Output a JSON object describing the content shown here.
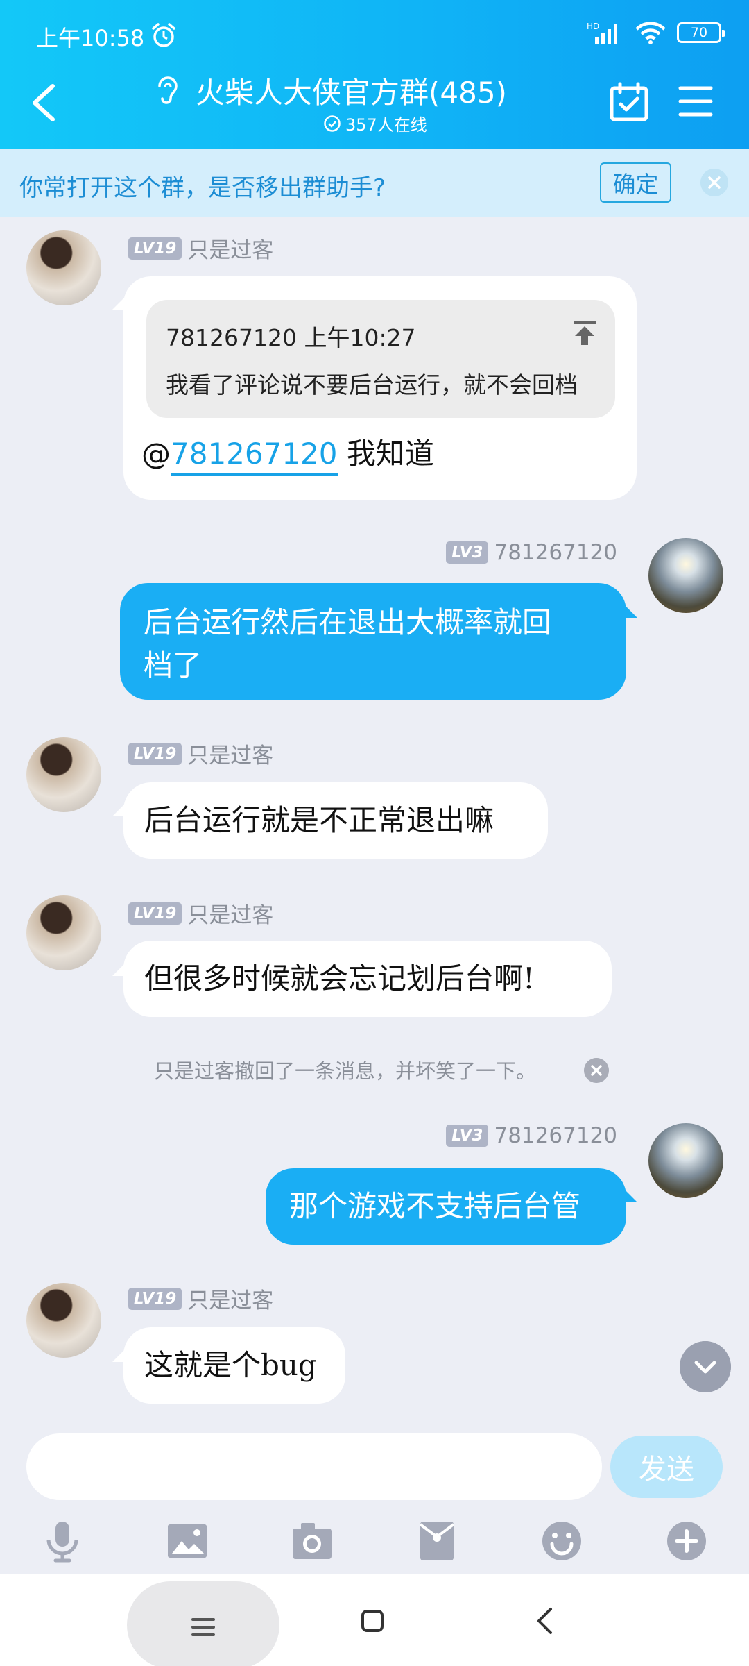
{
  "status_bar": {
    "time": "上午10:58",
    "network": "HD",
    "battery": "70"
  },
  "header": {
    "title": "火柴人大侠官方群(485)",
    "online": "357人在线"
  },
  "banner": {
    "text": "你常打开这个群，是否移出群助手?",
    "confirm": "确定"
  },
  "users": {
    "other": {
      "level": "LV19",
      "name": "只是过客"
    },
    "self": {
      "level": "LV3",
      "name": "781267120"
    }
  },
  "messages": {
    "m1": {
      "quote_author": "781267120 上午10:27",
      "quote_text": "我看了评论说不要后台运行，就不会回档",
      "mention": "@",
      "mention_name": "781267120",
      "text": "我知道"
    },
    "m2": {
      "line1": "后台运行然后在退出大概率就回",
      "line2": "档了"
    },
    "m3": {
      "text": "后台运行就是不正常退出嘛"
    },
    "m4": {
      "text": "但很多时候就会忘记划后台啊!"
    },
    "notice": "只是过客撤回了一条消息，并坏笑了一下。",
    "m5": {
      "text": "那个游戏不支持后台管"
    },
    "m6": {
      "text": "这就是个bug"
    }
  },
  "input": {
    "send": "发送"
  },
  "toolbar": [
    "mic-icon",
    "image-icon",
    "camera-icon",
    "red-packet-icon",
    "emoji-icon",
    "plus-icon"
  ],
  "colors": {
    "header": "#10b4f6",
    "bubble_self": "#1aaef4",
    "background": "#eceef5"
  }
}
